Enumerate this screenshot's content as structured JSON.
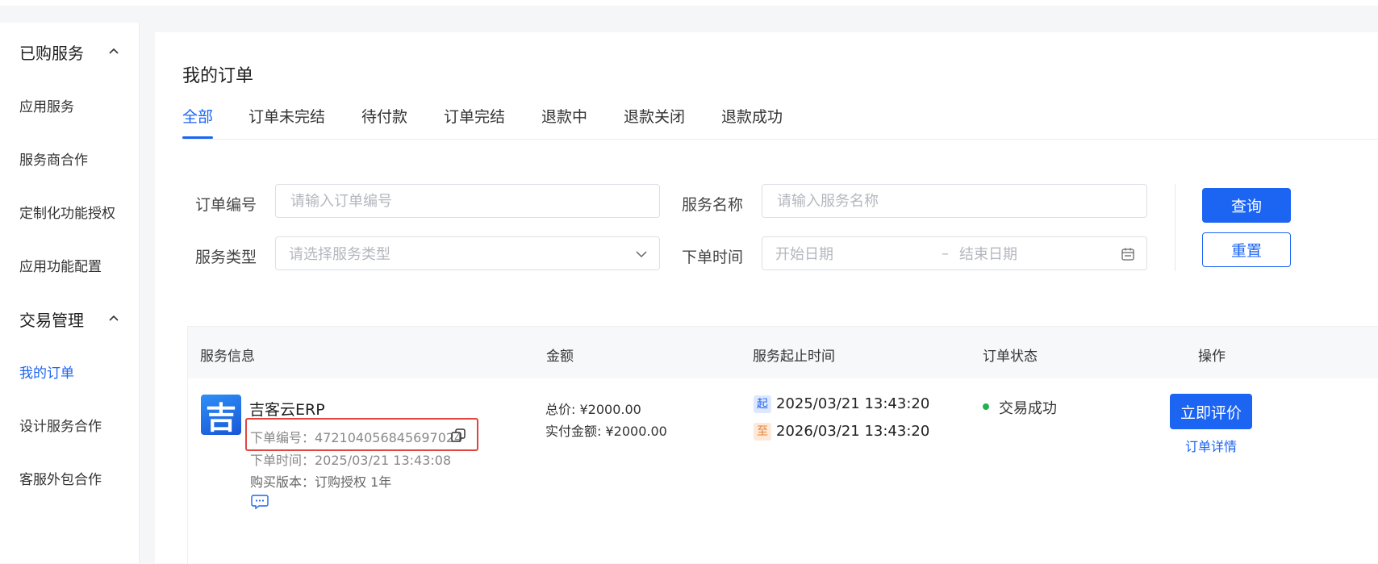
{
  "sidebar": {
    "groups": [
      {
        "label": "已购服务",
        "items": [
          "应用服务",
          "服务商合作",
          "定制化功能授权",
          "应用功能配置"
        ]
      },
      {
        "label": "交易管理",
        "items": [
          "我的订单",
          "设计服务合作",
          "客服外包合作"
        ]
      }
    ],
    "active_item": "我的订单"
  },
  "page": {
    "title": "我的订单"
  },
  "tabs": [
    "全部",
    "订单未完结",
    "待付款",
    "订单完结",
    "退款中",
    "退款关闭",
    "退款成功"
  ],
  "filters": {
    "order_no": {
      "label": "订单编号",
      "placeholder": "请输入订单编号"
    },
    "service_name": {
      "label": "服务名称",
      "placeholder": "请输入服务名称"
    },
    "service_type": {
      "label": "服务类型",
      "placeholder": "请选择服务类型"
    },
    "order_time": {
      "label": "下单时间",
      "start_placeholder": "开始日期",
      "separator": "–",
      "end_placeholder": "结束日期"
    },
    "query_label": "查询",
    "reset_label": "重置"
  },
  "table": {
    "headers": [
      "服务信息",
      "金额",
      "服务起止时间",
      "订单状态",
      "操作"
    ],
    "rows": [
      {
        "logo_glyph": "吉",
        "service_name": "吉客云ERP",
        "order_no": "下单编号：472104056845697024",
        "order_time": "下单时间：2025/03/21 13:43:08",
        "version": "购买版本：订购授权 1年",
        "total_price": "总价: ¥2000.00",
        "paid_amount": "实付金额: ¥2000.00",
        "start_badge": "起",
        "start_time": "2025/03/21 13:43:20",
        "end_badge": "至",
        "end_time": "2026/03/21 13:43:20",
        "status": "交易成功",
        "review_label": "立即评价",
        "detail_label": "订单详情"
      }
    ]
  },
  "colors": {
    "primary": "#1c64f2",
    "success_dot": "#22b14c",
    "highlight": "#e0463e",
    "start_badge_bg": "#dde8ff",
    "end_badge_bg": "#fde9d9"
  }
}
